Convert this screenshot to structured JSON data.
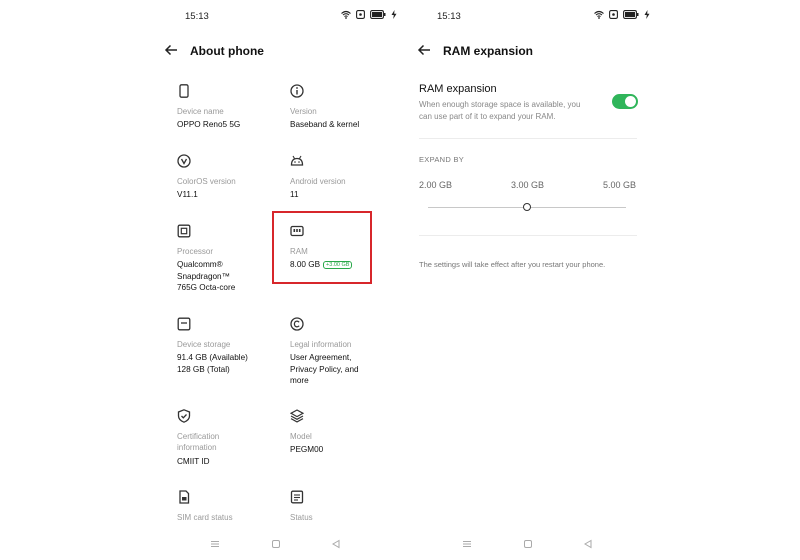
{
  "left_screen": {
    "status_time": "15:13",
    "title": "About phone",
    "items": [
      {
        "label": "Device name",
        "value": "OPPO Reno5 5G",
        "icon": "phone-icon"
      },
      {
        "label": "Version",
        "value": "Baseband & kernel",
        "icon": "info-icon"
      },
      {
        "label": "ColorOS version",
        "value": "V11.1",
        "icon": "coloros-icon"
      },
      {
        "label": "Android version",
        "value": "11",
        "icon": "android-icon"
      },
      {
        "label": "Processor",
        "value": "Qualcomm®\nSnapdragon™\n765G Octa-core",
        "icon": "processor-icon"
      },
      {
        "label": "RAM",
        "value": "8.00 GB",
        "badge": "+3.00 GB",
        "icon": "ram-icon"
      },
      {
        "label": "Device storage",
        "value": "91.4 GB (Available)\n128 GB (Total)",
        "icon": "storage-icon"
      },
      {
        "label": "Legal information",
        "value": "User Agreement,\nPrivacy Policy, and\nmore",
        "icon": "copyright-icon"
      },
      {
        "label": "Certification\ninformation",
        "value": "CMIIT ID",
        "icon": "certification-icon"
      },
      {
        "label": "Model",
        "value": "PEGM00",
        "icon": "layers-icon"
      },
      {
        "label": "SIM card status",
        "value": "",
        "icon": "sim-card-icon"
      },
      {
        "label": "Status",
        "value": "",
        "icon": "status-icon"
      }
    ]
  },
  "right_screen": {
    "status_time": "15:13",
    "title": "RAM expansion",
    "setting_title": "RAM expansion",
    "setting_desc": "When enough storage space is available, you\ncan use part of it to expand your RAM.",
    "toggle_on": true,
    "section_header": "EXPAND BY",
    "options": [
      "2.00 GB",
      "3.00 GB",
      "5.00 GB"
    ],
    "selected_option": "3.00 GB",
    "note": "The settings will take effect after you restart your phone."
  },
  "colors": {
    "accent": "#2fb55a",
    "highlight": "#d7262b"
  }
}
